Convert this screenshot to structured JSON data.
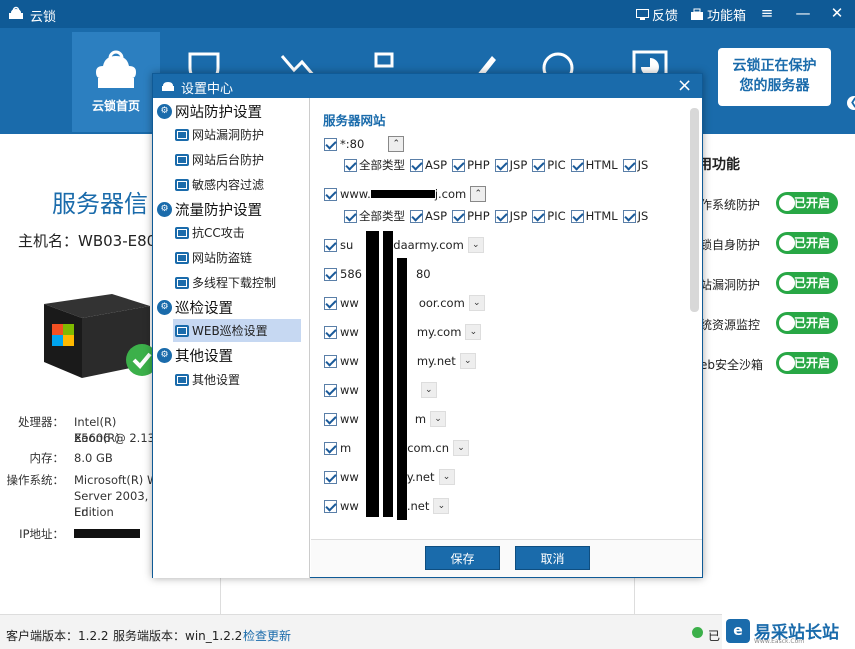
{
  "app": {
    "title": "云锁",
    "feedback": "反馈",
    "toolbox": "功能箱"
  },
  "nav": {
    "home_label": "云锁首页",
    "protect_line1": "云锁正在保护",
    "protect_line2": "您的服务器"
  },
  "main": {
    "server_title": "服务器信",
    "host_label": "主机名：WB03-E80",
    "specs": {
      "cpu_label": "处理器：",
      "cpu_value_1": "Intel(R) Xeon(R)",
      "cpu_value_2": "E5606  @ 2.13G",
      "mem_label": "内存：",
      "mem_value": "8.0 GB",
      "os_label": "操作系统：",
      "os_value_1": "Microsoft(R) Wi",
      "os_value_2": "Server 2003, En",
      "os_value_3": "Edition",
      "ip_label": "IP地址："
    },
    "features_title": "用功能",
    "features": [
      {
        "label": "作系统防护",
        "status": "已开启"
      },
      {
        "label": "锁自身防护",
        "status": "已开启"
      },
      {
        "label": "站漏洞防护",
        "status": "已开启"
      },
      {
        "label": "统资源监控",
        "status": "已开启"
      },
      {
        "label": "eb安全沙箱",
        "status": "已开启"
      }
    ]
  },
  "status": {
    "client_version": "客户端版本：1.2.2",
    "server_version": "服务端版本：win_1.2.2",
    "check_update": "检查更新",
    "online_partial": "已"
  },
  "watermark": {
    "logo": "e",
    "text": "易采站长站",
    "sub": "Www.Easck.Com"
  },
  "dialog": {
    "title": "设置中心",
    "close": "×",
    "tree": {
      "groups": [
        {
          "label": "网站防护设置",
          "items": [
            "网站漏洞防护",
            "网站后台防护",
            "敏感内容过滤"
          ]
        },
        {
          "label": "流量防护设置",
          "items": [
            "抗CC攻击",
            "网站防盗链",
            "多线程下载控制"
          ]
        },
        {
          "label": "巡检设置",
          "items": [
            "WEB巡检设置"
          ]
        },
        {
          "label": "其他设置",
          "items": [
            "其他设置"
          ]
        }
      ]
    },
    "panel": {
      "section_title": "服务器网站",
      "sites": [
        {
          "label": "*:80",
          "chev": "⌃"
        },
        {
          "label": "www.",
          "label_tail": "j.com",
          "chev": "⌃"
        },
        {
          "label": "su",
          "label_tail": "daarmy.com",
          "chev": "⌄"
        },
        {
          "label": "586",
          "label_tail": "80",
          "chev": "⌄"
        },
        {
          "label": "ww",
          "label_tail": "oor.com",
          "chev": "⌄"
        },
        {
          "label": "ww",
          "label_tail": "my.com",
          "chev": "⌄"
        },
        {
          "label": "ww",
          "label_tail": "my.net",
          "chev": "⌄"
        },
        {
          "label": "ww",
          "label_tail": "",
          "chev": "⌄"
        },
        {
          "label": "ww",
          "label_tail": "m",
          "chev": "⌄"
        },
        {
          "label": "m",
          "label_tail": "com.cn",
          "chev": "⌄"
        },
        {
          "label": "ww",
          "label_tail": "y.net",
          "chev": "⌄"
        },
        {
          "label": "ww",
          "label_tail": ".net",
          "chev": "⌄"
        }
      ],
      "types": [
        "全部类型",
        "ASP",
        "PHP",
        "JSP",
        "PIC",
        "HTML",
        "JS"
      ]
    },
    "buttons": {
      "save": "保存",
      "cancel": "取消"
    }
  }
}
